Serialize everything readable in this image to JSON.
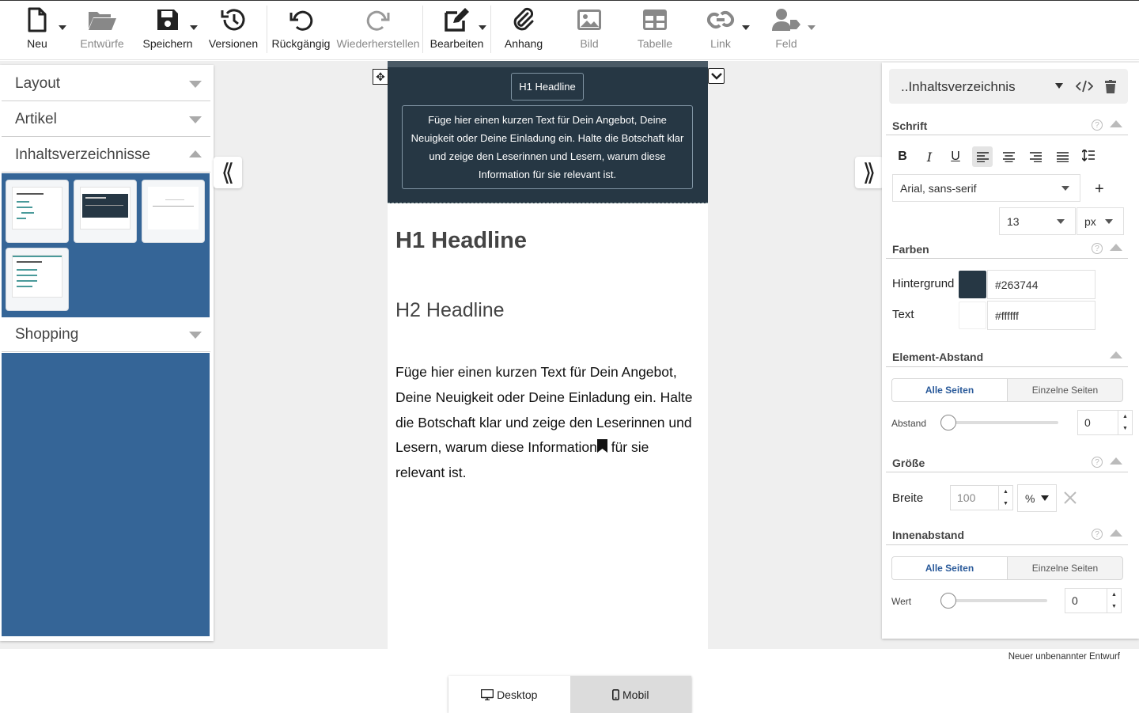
{
  "toolbar": {
    "new_label": "Neu",
    "drafts_label": "Entwürfe",
    "save_label": "Speichern",
    "versions_label": "Versionen",
    "undo_label": "Rückgängig",
    "redo_label": "Wiederherstellen",
    "edit_label": "Bearbeiten",
    "attachment_label": "Anhang",
    "image_label": "Bild",
    "table_label": "Tabelle",
    "link_label": "Link",
    "field_label": "Feld"
  },
  "left_panel": {
    "sections": [
      "Layout",
      "Artikel",
      "Inhaltsverzeichnisse",
      "Shopping"
    ],
    "expanded": "Inhaltsverzeichnisse"
  },
  "canvas": {
    "block_headline": "H1 Headline",
    "block_text": "Füge hier einen kurzen Text für Dein Angebot, Deine Neuigkeit oder Deine Einladung ein. Halte die Botschaft klar und zeige den Leserinnen und Lesern, warum diese Information für sie relevant ist.",
    "h1": "H1 Headline",
    "h2": "H2 Headline",
    "paragraph_part1": "Füge hier einen kurzen Text für Dein Angebot, Deine Neuigkeit oder Deine Einladung ein. Halte die Botschaft klar und zeige den Leserinnen und Lesern, warum diese Information",
    "paragraph_part2": " für sie relevant ist."
  },
  "right_panel": {
    "element_select": "..Inhaltsverzeichnis",
    "font_section": "Schrift",
    "font_family": "Arial, sans-serif",
    "font_size": "13",
    "font_unit": "px",
    "colors_section": "Farben",
    "bg_label": "Hintergrund",
    "bg_value": "#263744",
    "text_label": "Text",
    "text_value": "#ffffff",
    "spacing_section": "Element-Abstand",
    "all_sides": "Alle Seiten",
    "single_sides": "Einzelne Seiten",
    "spacing_label": "Abstand",
    "spacing_value": "0",
    "size_section": "Größe",
    "width_label": "Breite",
    "width_value": "100",
    "width_unit": "%",
    "padding_section": "Innenabstand",
    "padding_all_sides": "Alle Seiten",
    "padding_single_sides": "Einzelne Seiten",
    "padding_label": "Wert",
    "padding_value": "0"
  },
  "status_text": "Neuer unbenannter Entwurf",
  "view_toggle": {
    "desktop": "Desktop",
    "mobile": "Mobil"
  },
  "colors": {
    "block_bg": "#263744",
    "accordion_body": "#356597",
    "accent": "#2a5a9a"
  }
}
